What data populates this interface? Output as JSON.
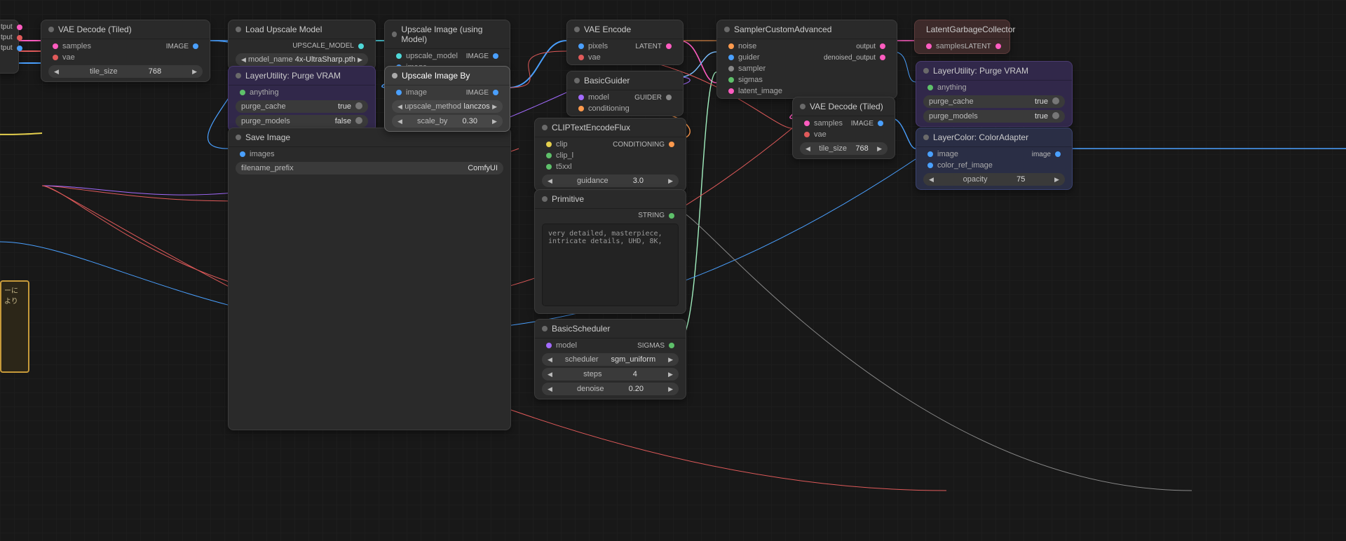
{
  "p0": {
    "o0": "tput",
    "o1": "tput",
    "o2": "tput"
  },
  "n0": {
    "title": "VAE Decode (Tiled)",
    "i0": "samples",
    "i1": "vae",
    "o0": "IMAGE",
    "w0n": "tile_size",
    "w0v": "768"
  },
  "n1": {
    "title": "Load Upscale Model",
    "o0": "UPSCALE_MODEL",
    "w0n": "model_name",
    "w0v": "4x-UltraSharp.pth"
  },
  "n2": {
    "title": "LayerUtility: Purge VRAM",
    "i0": "anything",
    "w0n": "purge_cache",
    "w0v": "true",
    "w1n": "purge_models",
    "w1v": "false"
  },
  "n3": {
    "title": "Save Image",
    "i0": "images",
    "w0n": "filename_prefix",
    "w0v": "ComfyUI"
  },
  "n4": {
    "title": "Upscale Image (using Model)",
    "i0": "upscale_model",
    "i1": "image",
    "o0": "IMAGE"
  },
  "n5": {
    "title": "Upscale Image By",
    "i0": "image",
    "o0": "IMAGE",
    "w0n": "upscale_method",
    "w0v": "lanczos",
    "w1n": "scale_by",
    "w1v": "0.30"
  },
  "n6": {
    "title": "VAE Encode",
    "i0": "pixels",
    "i1": "vae",
    "o0": "LATENT"
  },
  "n7": {
    "title": "BasicGuider",
    "i0": "model",
    "i1": "conditioning",
    "o0": "GUIDER"
  },
  "n8": {
    "title": "CLIPTextEncodeFlux",
    "i0": "clip",
    "i1": "clip_l",
    "i2": "t5xxl",
    "o0": "CONDITIONING",
    "w0n": "guidance",
    "w0v": "3.0"
  },
  "n9": {
    "title": "Primitive",
    "o0": "STRING",
    "text": "very detailed, masterpiece, intricate details, UHD, 8K,"
  },
  "n10": {
    "title": "BasicScheduler",
    "i0": "model",
    "o0": "SIGMAS",
    "w0n": "scheduler",
    "w0v": "sgm_uniform",
    "w1n": "steps",
    "w1v": "4",
    "w2n": "denoise",
    "w2v": "0.20"
  },
  "n11": {
    "title": "SamplerCustomAdvanced",
    "i0": "noise",
    "i1": "guider",
    "i2": "sampler",
    "i3": "sigmas",
    "i4": "latent_image",
    "o0": "output",
    "o1": "denoised_output"
  },
  "n12": {
    "title": "LatentGarbageCollector",
    "i0": "samples",
    "o0": "LATENT"
  },
  "n13": {
    "title": "LayerUtility: Purge VRAM",
    "i0": "anything",
    "w0n": "purge_cache",
    "w0v": "true",
    "w1n": "purge_models",
    "w1v": "true"
  },
  "n14": {
    "title": "VAE Decode (Tiled)",
    "i0": "samples",
    "i1": "vae",
    "o0": "IMAGE",
    "w0n": "tile_size",
    "w0v": "768"
  },
  "n15": {
    "title": "LayerColor: ColorAdapter",
    "i0": "image",
    "i1": "color_ref_image",
    "o0": "image",
    "w0n": "opacity",
    "w0v": "75"
  },
  "jap": "ーに\n\nより"
}
